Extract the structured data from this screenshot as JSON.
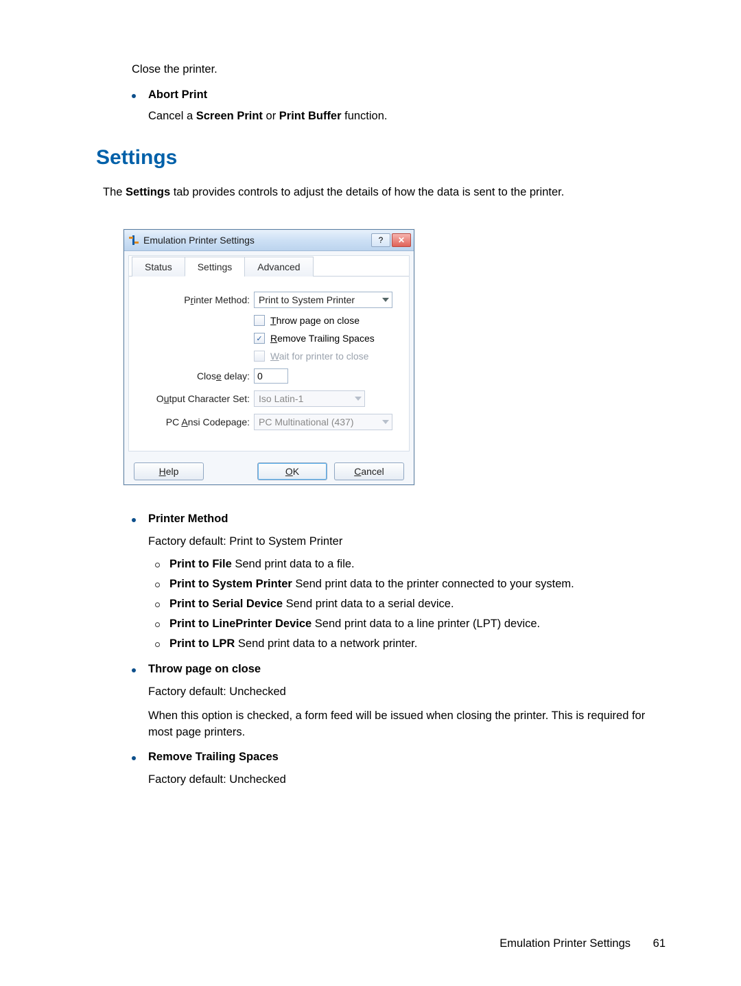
{
  "intro": {
    "close_printer": "Close the printer.",
    "abort_print_label": "Abort Print",
    "abort_print_desc_pre": "Cancel a ",
    "abort_print_desc_b1": "Screen Print",
    "abort_print_desc_mid": " or ",
    "abort_print_desc_b2": "Print Buffer",
    "abort_print_desc_post": " function."
  },
  "heading": "Settings",
  "settings_para_pre": "The ",
  "settings_para_bold": "Settings",
  "settings_para_post": " tab provides controls to adjust the details of how the data is sent to the printer.",
  "dialog": {
    "title": "Emulation Printer Settings",
    "tabs": {
      "status": "Status",
      "settings": "Settings",
      "advanced": "Advanced"
    },
    "labels": {
      "printer_method_pre": "P",
      "printer_method_u": "r",
      "printer_method_post": "inter Method:",
      "throw_u": "T",
      "throw_post": "hrow page on close",
      "remove_u": "R",
      "remove_post": "emove Trailing Spaces",
      "wait_u": "W",
      "wait_post": "ait for printer to close",
      "closedelay_pre": "Clos",
      "closedelay_u": "e",
      "closedelay_post": " delay:",
      "ocs_pre": "O",
      "ocs_u": "u",
      "ocs_post": "tput Character Set:",
      "pcacp_pre": "PC ",
      "pcacp_u": "A",
      "pcacp_post": "nsi Codepage:"
    },
    "values": {
      "printer_method": "Print to System Printer",
      "throw_checked": false,
      "remove_checked": true,
      "wait_checked": false,
      "close_delay": "0",
      "output_charset": "Iso Latin-1",
      "pc_ansi_codepage": "PC Multinational (437)"
    },
    "buttons": {
      "help_u": "H",
      "help_post": "elp",
      "ok_u": "O",
      "ok_post": "K",
      "cancel_u": "C",
      "cancel_post": "ancel"
    }
  },
  "doc": {
    "pm": {
      "title": "Printer Method",
      "default": "Factory default: Print to System Printer",
      "items": [
        {
          "b": "Print to File",
          "t": " Send print data to a file."
        },
        {
          "b": "Print to System Printer",
          "t": " Send print data to the printer connected to your system."
        },
        {
          "b": "Print to Serial Device",
          "t": " Send print data to a serial device."
        },
        {
          "b": "Print to LinePrinter Device",
          "t": " Send print data to a line printer (LPT) device."
        },
        {
          "b": "Print to LPR",
          "t": " Send print data to a network printer."
        }
      ]
    },
    "throw": {
      "title": "Throw page on close",
      "default": "Factory default: Unchecked",
      "desc": "When this option is checked, a form feed will be issued when closing the printer. This is required for most page printers."
    },
    "rts": {
      "title": "Remove Trailing Spaces",
      "default": "Factory default: Unchecked"
    }
  },
  "footer": {
    "text": "Emulation Printer Settings",
    "page": "61"
  }
}
